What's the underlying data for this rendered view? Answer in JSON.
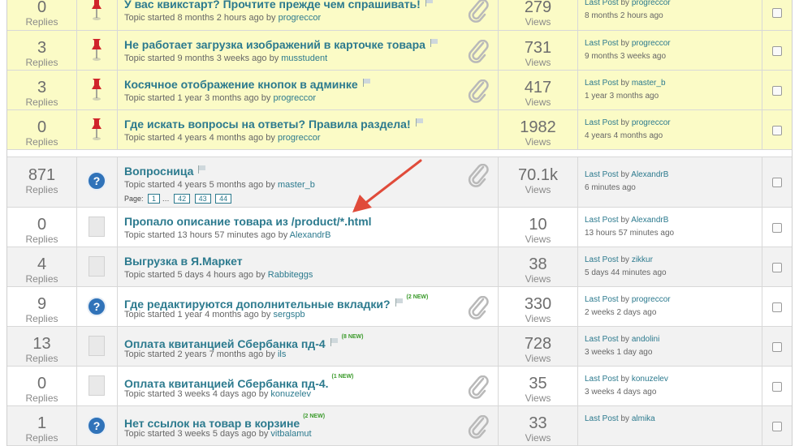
{
  "topics": [
    {
      "replies": "0",
      "replies_label": "Replies",
      "title": "У вас квикстарт? Прочтите прежде чем спрашивать!",
      "started_prefix": "Topic started",
      "started_ago": "8 months 2 hours ago",
      "by": "by",
      "author": "progreccor",
      "views": "279",
      "views_label": "Views",
      "last_label": "Last Post",
      "last_by": "by",
      "last_user": "progreccor",
      "last_time": "8 months 2 hours ago"
    },
    {
      "replies": "3",
      "replies_label": "Replies",
      "title": "Не работает загрузка изображений в карточке товара",
      "started_prefix": "Topic started",
      "started_ago": "9 months 3 weeks ago",
      "by": "by",
      "author": "musstudent",
      "views": "731",
      "views_label": "Views",
      "last_label": "Last Post",
      "last_by": "by",
      "last_user": "progreccor",
      "last_time": "9 months 3 weeks ago"
    },
    {
      "replies": "3",
      "replies_label": "Replies",
      "title": "Косячное отображение кнопок в админке",
      "started_prefix": "Topic started",
      "started_ago": "1 year 3 months ago",
      "by": "by",
      "author": "progreccor",
      "views": "417",
      "views_label": "Views",
      "last_label": "Last Post",
      "last_by": "by",
      "last_user": "master_b",
      "last_time": "1 year 3 months ago"
    },
    {
      "replies": "0",
      "replies_label": "Replies",
      "title": "Где искать вопросы на ответы? Правила раздела!",
      "started_prefix": "Topic started",
      "started_ago": "4 years 4 months ago",
      "by": "by",
      "author": "progreccor",
      "views": "1982",
      "views_label": "Views",
      "last_label": "Last Post",
      "last_by": "by",
      "last_user": "progreccor",
      "last_time": "4 years 4 months ago"
    },
    {
      "replies": "871",
      "replies_label": "Replies",
      "title": "Вопросница",
      "started_prefix": "Topic started",
      "started_ago": "4 years 5 months ago",
      "by": "by",
      "author": "master_b",
      "views": "70.1k",
      "views_label": "Views",
      "last_label": "Last Post",
      "last_by": "by",
      "last_user": "AlexandrB",
      "last_time": "6 minutes ago",
      "pages_label": "Page:",
      "pages": [
        "1",
        "…",
        "42",
        "43",
        "44"
      ]
    },
    {
      "replies": "0",
      "replies_label": "Replies",
      "title": "Пропало описание товара из /product/*.html",
      "started_prefix": "Topic started",
      "started_ago": "13 hours 57 minutes ago",
      "by": "by",
      "author": "AlexandrB",
      "views": "10",
      "views_label": "Views",
      "last_label": "Last Post",
      "last_by": "by",
      "last_user": "AlexandrB",
      "last_time": "13 hours 57 minutes ago"
    },
    {
      "replies": "4",
      "replies_label": "Replies",
      "title": "Выгрузка в Я.Маркет",
      "started_prefix": "Topic started",
      "started_ago": "5 days 4 hours ago",
      "by": "by",
      "author": "Rabbiteggs",
      "views": "38",
      "views_label": "Views",
      "last_label": "Last Post",
      "last_by": "by",
      "last_user": "zikkur",
      "last_time": "5 days 44 minutes ago"
    },
    {
      "replies": "9",
      "replies_label": "Replies",
      "title": "Где редактируются дополнительные вкладки?",
      "new_badge": "(2 NEW)",
      "started_prefix": "Topic started",
      "started_ago": "1 year 4 months ago",
      "by": "by",
      "author": "sergspb",
      "views": "330",
      "views_label": "Views",
      "last_label": "Last Post",
      "last_by": "by",
      "last_user": "progreccor",
      "last_time": "2 weeks 2 days ago"
    },
    {
      "replies": "13",
      "replies_label": "Replies",
      "title": "Оплата квитанцией Сбербанка пд-4",
      "new_badge": "(8 NEW)",
      "started_prefix": "Topic started",
      "started_ago": "2 years 7 months ago",
      "by": "by",
      "author": "ils",
      "views": "728",
      "views_label": "Views",
      "last_label": "Last Post",
      "last_by": "by",
      "last_user": "andolini",
      "last_time": "3 weeks 1 day ago"
    },
    {
      "replies": "0",
      "replies_label": "Replies",
      "title": "Оплата квитанцией Сбербанка пд-4.",
      "new_badge": "(1 NEW)",
      "started_prefix": "Topic started",
      "started_ago": "3 weeks 4 days ago",
      "by": "by",
      "author": "konuzelev",
      "views": "35",
      "views_label": "Views",
      "last_label": "Last Post",
      "last_by": "by",
      "last_user": "konuzelev",
      "last_time": "3 weeks 4 days ago"
    },
    {
      "replies": "1",
      "replies_label": "Replies",
      "title": "Нет ссылок на товар в корзине",
      "new_badge": "(2 NEW)",
      "started_prefix": "Topic started",
      "started_ago": "3 weeks 5 days ago",
      "by": "by",
      "author": "vitbalamut",
      "views": "33",
      "views_label": "Views",
      "last_label": "Last Post",
      "last_by": "by",
      "last_user": "almika",
      "last_time": ""
    }
  ],
  "colors": {
    "link": "#2c7a8e",
    "sticky_bg": "#fbfbc6",
    "row_bg": "#f2f2f2",
    "arrow": "#e04b3a",
    "new_badge": "#3a9a2a"
  }
}
